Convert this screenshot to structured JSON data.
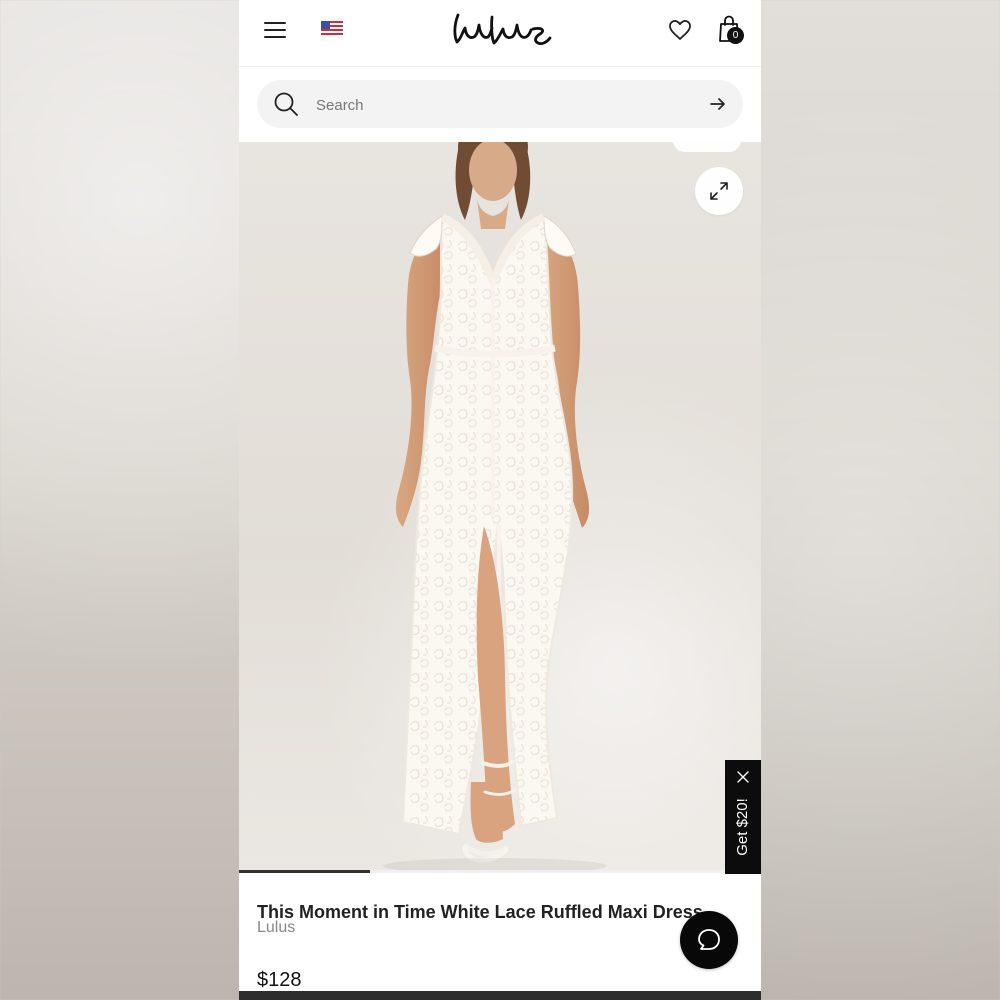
{
  "header": {
    "brand_logo": "Lulus",
    "cart_count": "0"
  },
  "search": {
    "placeholder": "Search"
  },
  "product": {
    "title": "This Moment in Time White Lace Ruffled Maxi Dress",
    "brand": "Lulus",
    "price": "$128",
    "image_progress_fraction": 0.25
  },
  "promo": {
    "label": "Get $20!"
  },
  "icons": {
    "menu": "hamburger-icon",
    "country": "us-flag-icon",
    "wishlist": "heart-icon",
    "cart": "shopping-bag-icon",
    "search": "search-icon",
    "submit": "arrow-right-icon",
    "expand": "expand-icon",
    "close": "close-icon",
    "chat": "chat-icon"
  },
  "colors": {
    "text": "#222222",
    "muted": "#888888",
    "black": "#0c0c0c",
    "search_bg": "#f3f3f4"
  }
}
